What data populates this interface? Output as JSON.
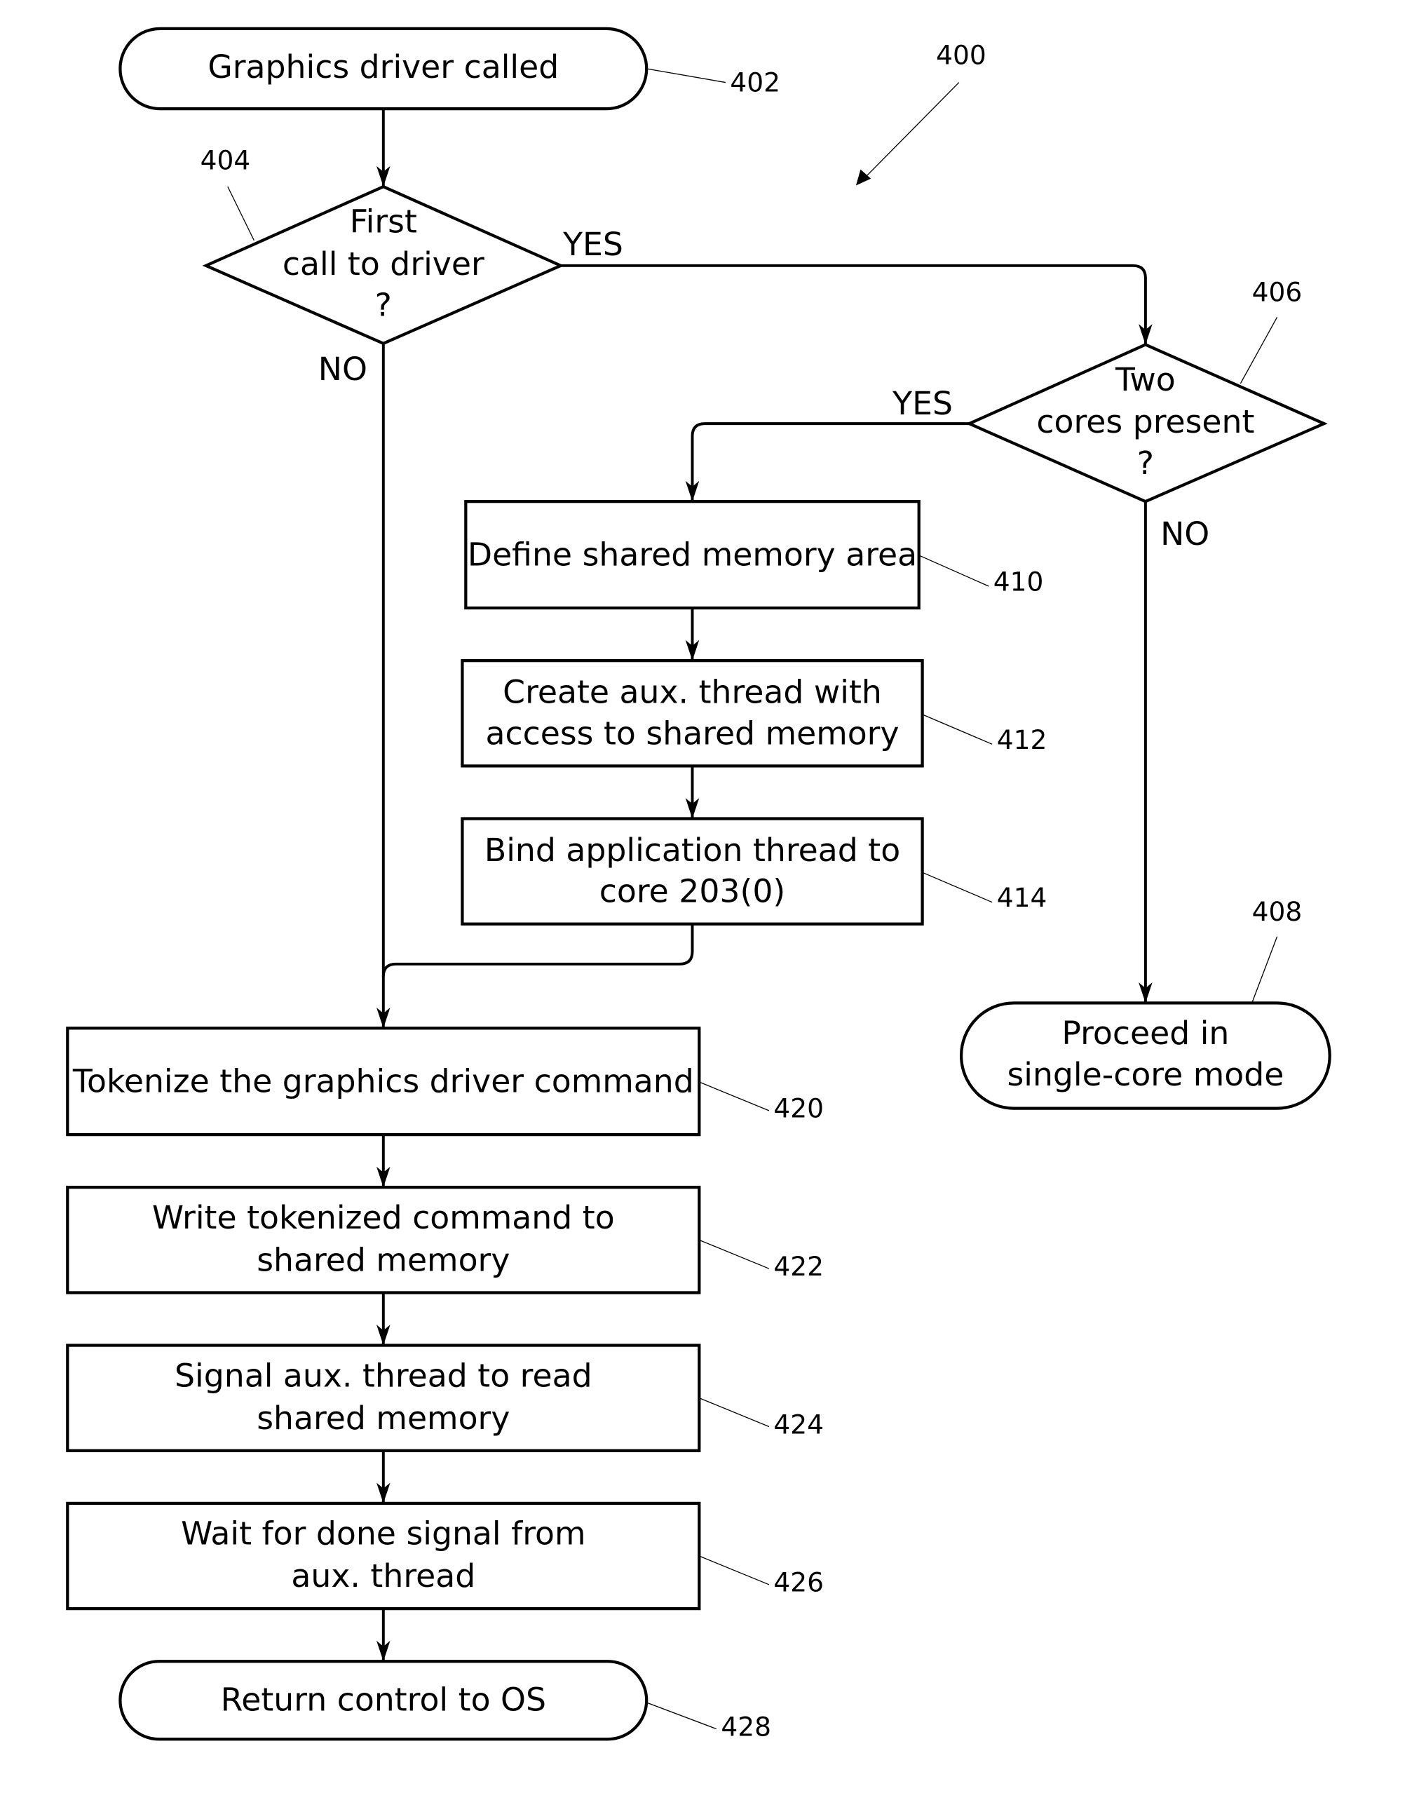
{
  "figure": {
    "reference": "400"
  },
  "nodes": {
    "n402": {
      "ref": "402",
      "type": "terminal",
      "lines": [
        "Graphics driver called"
      ]
    },
    "n404": {
      "ref": "404",
      "type": "decision",
      "lines": [
        "First",
        "call to driver",
        "?"
      ]
    },
    "n406": {
      "ref": "406",
      "type": "decision",
      "lines": [
        "Two",
        "cores present",
        "?"
      ]
    },
    "n408": {
      "ref": "408",
      "type": "terminal",
      "lines": [
        "Proceed in",
        "single-core mode"
      ]
    },
    "n410": {
      "ref": "410",
      "type": "process",
      "lines": [
        "Define shared memory area"
      ]
    },
    "n412": {
      "ref": "412",
      "type": "process",
      "lines": [
        "Create aux. thread with",
        "access to shared memory"
      ]
    },
    "n414": {
      "ref": "414",
      "type": "process",
      "lines": [
        "Bind application thread to",
        "core 203(0)"
      ]
    },
    "n420": {
      "ref": "420",
      "type": "process",
      "lines": [
        "Tokenize the graphics driver command"
      ]
    },
    "n422": {
      "ref": "422",
      "type": "process",
      "lines": [
        "Write tokenized command to",
        "shared memory"
      ]
    },
    "n424": {
      "ref": "424",
      "type": "process",
      "lines": [
        "Signal aux. thread to read",
        "shared memory"
      ]
    },
    "n426": {
      "ref": "426",
      "type": "process",
      "lines": [
        "Wait for done signal from",
        "aux. thread"
      ]
    },
    "n428": {
      "ref": "428",
      "type": "terminal",
      "lines": [
        "Return control to OS"
      ]
    }
  },
  "edges": [
    {
      "from": "402",
      "to": "404",
      "label": ""
    },
    {
      "from": "404",
      "to": "406",
      "label": "YES"
    },
    {
      "from": "404",
      "to": "420",
      "label": "NO"
    },
    {
      "from": "406",
      "to": "410",
      "label": "YES"
    },
    {
      "from": "406",
      "to": "408",
      "label": "NO"
    },
    {
      "from": "410",
      "to": "412",
      "label": ""
    },
    {
      "from": "412",
      "to": "414",
      "label": ""
    },
    {
      "from": "414",
      "to": "420",
      "label": ""
    },
    {
      "from": "420",
      "to": "422",
      "label": ""
    },
    {
      "from": "422",
      "to": "424",
      "label": ""
    },
    {
      "from": "424",
      "to": "426",
      "label": ""
    },
    {
      "from": "426",
      "to": "428",
      "label": ""
    }
  ],
  "branch_labels": {
    "b404_yes": "YES",
    "b404_no": "NO",
    "b406_yes": "YES",
    "b406_no": "NO"
  }
}
